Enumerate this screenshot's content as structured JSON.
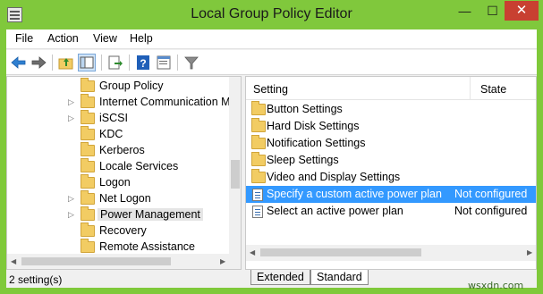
{
  "window": {
    "title": "Local Group Policy Editor",
    "controls": {
      "minimize": "—",
      "maximize": "☐",
      "close": "✕"
    },
    "accent_color": "#80c83c",
    "close_color": "#c84031"
  },
  "menubar": {
    "items": [
      {
        "label": "File"
      },
      {
        "label": "Action"
      },
      {
        "label": "View"
      },
      {
        "label": "Help"
      }
    ]
  },
  "toolbar": {
    "buttons": [
      {
        "icon": "back-arrow-icon"
      },
      {
        "icon": "forward-arrow-icon"
      },
      {
        "icon": "up-folder-icon"
      },
      {
        "icon": "show-hide-tree-icon"
      },
      {
        "icon": "export-list-icon"
      },
      {
        "icon": "help-icon"
      },
      {
        "icon": "properties-icon"
      },
      {
        "icon": "filter-icon"
      }
    ]
  },
  "tree": {
    "items": [
      {
        "label": "Group Policy",
        "expandable": false
      },
      {
        "label": "Internet Communication M",
        "expandable": true
      },
      {
        "label": "iSCSI",
        "expandable": true
      },
      {
        "label": "KDC",
        "expandable": false
      },
      {
        "label": "Kerberos",
        "expandable": false
      },
      {
        "label": "Locale Services",
        "expandable": false
      },
      {
        "label": "Logon",
        "expandable": false
      },
      {
        "label": "Net Logon",
        "expandable": true
      },
      {
        "label": "Power Management",
        "expandable": true,
        "selected": true
      },
      {
        "label": "Recovery",
        "expandable": false
      },
      {
        "label": "Remote Assistance",
        "expandable": false
      }
    ]
  },
  "list": {
    "columns": {
      "setting": "Setting",
      "state": "State"
    },
    "rows": [
      {
        "type": "folder",
        "label": "Button Settings",
        "state": ""
      },
      {
        "type": "folder",
        "label": "Hard Disk Settings",
        "state": ""
      },
      {
        "type": "folder",
        "label": "Notification Settings",
        "state": ""
      },
      {
        "type": "folder",
        "label": "Sleep Settings",
        "state": ""
      },
      {
        "type": "folder",
        "label": "Video and Display Settings",
        "state": ""
      },
      {
        "type": "policy",
        "label": "Specify a custom active power plan",
        "state": "Not configured",
        "selected": true
      },
      {
        "type": "policy",
        "label": "Select an active power plan",
        "state": "Not configured"
      }
    ],
    "selection_color": "#3399ff"
  },
  "tabs": {
    "items": [
      {
        "label": "Extended",
        "active": false
      },
      {
        "label": "Standard",
        "active": true
      }
    ]
  },
  "status": {
    "text": "2 setting(s)"
  },
  "watermark": "wsxdn.com"
}
